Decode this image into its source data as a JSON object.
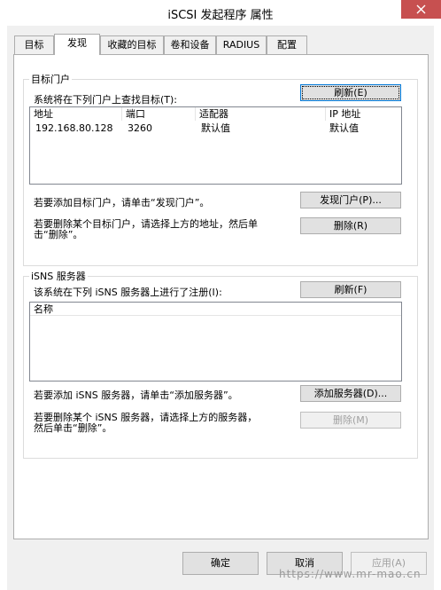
{
  "window": {
    "title": "iSCSI 发起程序 属性"
  },
  "tabs": [
    {
      "label": "目标"
    },
    {
      "label": "发现"
    },
    {
      "label": "收藏的目标"
    },
    {
      "label": "卷和设备"
    },
    {
      "label": "RADIUS"
    },
    {
      "label": "配置"
    }
  ],
  "target_portals": {
    "group_title": "目标门户",
    "description": "系统将在下列门户上查找目标(T):",
    "refresh_button": "刷新(E)",
    "columns": [
      "地址",
      "端口",
      "适配器",
      "IP 地址"
    ],
    "rows": [
      {
        "address": "192.168.80.128",
        "port": "3260",
        "adapter": "默认值",
        "ip": "默认值"
      }
    ],
    "add_hint": "若要添加目标门户，请单击“发现门户”。",
    "discover_button": "发现门户(P)...",
    "remove_hint_line1": "若要删除某个目标门户，请选择上方的地址，然后单",
    "remove_hint_line2": "击“删除”。",
    "remove_button": "删除(R)"
  },
  "isns": {
    "group_title": "iSNS 服务器",
    "description": "该系统在下列 iSNS 服务器上进行了注册(I):",
    "refresh_button": "刷新(F)",
    "columns": [
      "名称"
    ],
    "add_hint": "若要添加 iSNS 服务器，请单击“添加服务器”。",
    "add_button": "添加服务器(D)...",
    "remove_hint_line1": "若要删除某个 iSNS 服务器，请选择上方的服务器，",
    "remove_hint_line2": "然后单击“删除”。",
    "remove_button": "删除(M)"
  },
  "footer": {
    "ok": "确定",
    "cancel": "取消",
    "apply": "应用(A)"
  },
  "watermark": "https://www.mr-mao.cn"
}
